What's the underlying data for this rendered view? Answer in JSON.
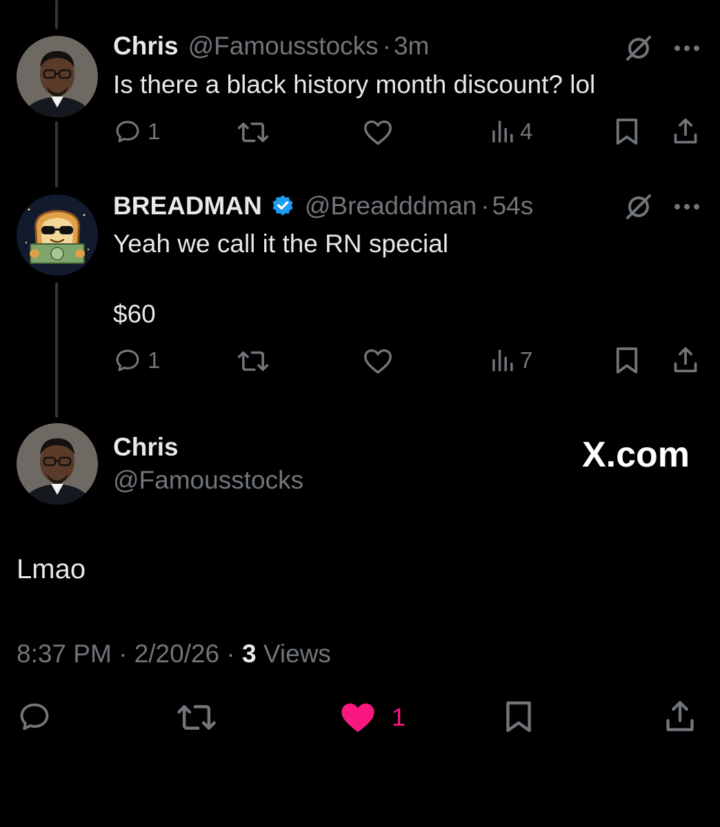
{
  "colors": {
    "background": "#000000",
    "text": "#e7e9ea",
    "muted": "#71767b",
    "like_active": "#f91880",
    "verified": "#1d9bf0"
  },
  "reply1": {
    "name": "Chris",
    "handle": "@Famousstocks",
    "time": "3m",
    "text": "Is there a black history month discount? lol",
    "replies": "1",
    "views": "4"
  },
  "reply2": {
    "name": "BREADMAN",
    "handle": "@Breadddman",
    "time": "54s",
    "text": "Yeah we call it the RN special\n\n$60",
    "replies": "1",
    "views": "7"
  },
  "main": {
    "name": "Chris",
    "handle": "@Famousstocks",
    "text": "Lmao",
    "time": "8:37 PM",
    "date": "2/20/26",
    "views_count": "3",
    "views_label": "Views",
    "likes": "1"
  },
  "watermark": "X.com",
  "separator": "·"
}
